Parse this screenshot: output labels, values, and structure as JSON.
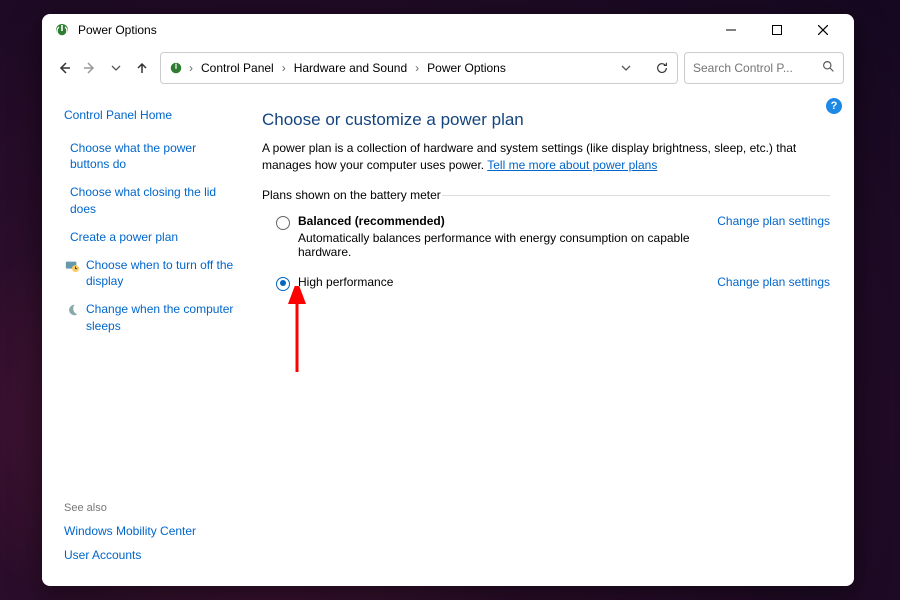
{
  "window": {
    "title": "Power Options"
  },
  "breadcrumb": {
    "root_glyph": "power-icon",
    "items": [
      "Control Panel",
      "Hardware and Sound",
      "Power Options"
    ]
  },
  "search": {
    "placeholder": "Search Control P..."
  },
  "help_badge": "?",
  "sidebar": {
    "home": "Control Panel Home",
    "items": [
      {
        "label": "Choose what the power buttons do",
        "icon": null
      },
      {
        "label": "Choose what closing the lid does",
        "icon": null
      },
      {
        "label": "Create a power plan",
        "icon": null
      },
      {
        "label": "Choose when to turn off the display",
        "icon": "display-timer-icon"
      },
      {
        "label": "Change when the computer sleeps",
        "icon": "moon-icon"
      }
    ],
    "see_also_header": "See also",
    "see_also": [
      "Windows Mobility Center",
      "User Accounts"
    ]
  },
  "main": {
    "heading": "Choose or customize a power plan",
    "description_pre": "A power plan is a collection of hardware and system settings (like display brightness, sleep, etc.) that manages how your computer uses power. ",
    "description_link": "Tell me more about power plans",
    "fieldset_label": "Plans shown on the battery meter",
    "plans": [
      {
        "name": "Balanced (recommended)",
        "desc": "Automatically balances performance with energy consumption on capable hardware.",
        "selected": false,
        "change_link": "Change plan settings"
      },
      {
        "name": "High performance",
        "desc": "",
        "selected": true,
        "change_link": "Change plan settings"
      }
    ]
  },
  "annotation": {
    "arrow_color": "#ff0000"
  }
}
